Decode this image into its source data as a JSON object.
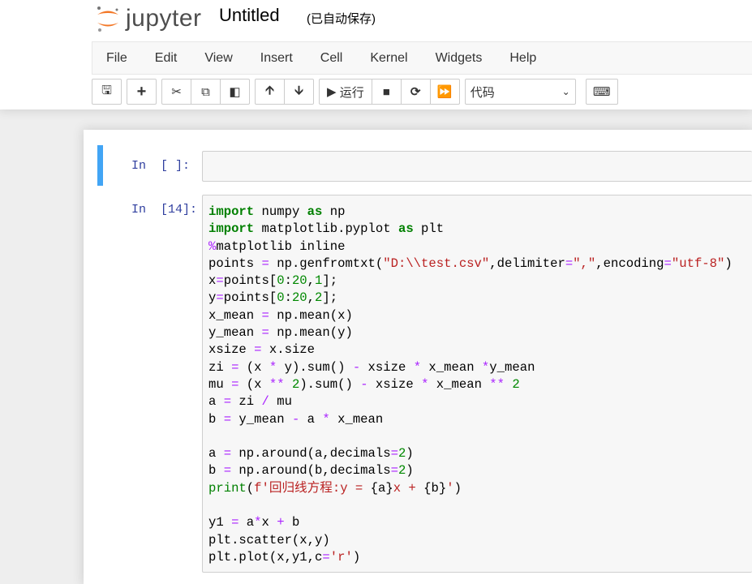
{
  "header": {
    "logo_text": "jupyter",
    "title": "Untitled",
    "save_status": "(已自动保存)"
  },
  "menu": [
    "File",
    "Edit",
    "View",
    "Insert",
    "Cell",
    "Kernel",
    "Widgets",
    "Help"
  ],
  "toolbar": {
    "run_label": "运行",
    "cell_type": "代码",
    "icons": [
      "save-icon",
      "plus-icon",
      "cut-icon",
      "copy-icon",
      "paste-icon",
      "arrow-up-icon",
      "arrow-down-icon",
      "play-icon",
      "stop-icon",
      "restart-icon",
      "fast-forward-icon",
      "keyboard-icon"
    ]
  },
  "cells": [
    {
      "prompt": "In  [ ]:"
    },
    {
      "prompt": "In  [14]:",
      "lines": [
        [
          [
            "import",
            "kw"
          ],
          [
            " numpy ",
            ""
          ],
          [
            "as",
            "kw"
          ],
          [
            " np",
            ""
          ]
        ],
        [
          [
            "import",
            "kw"
          ],
          [
            " matplotlib.pyplot ",
            ""
          ],
          [
            "as",
            "kw"
          ],
          [
            " plt",
            ""
          ]
        ],
        [
          [
            "%",
            "mg"
          ],
          [
            "matplotlib inline",
            ""
          ]
        ],
        [
          [
            "points ",
            ""
          ],
          [
            "=",
            "op"
          ],
          [
            " np.genfromtxt(",
            ""
          ],
          [
            "\"D:\\\\test.csv\"",
            "str"
          ],
          [
            ",delimiter",
            ""
          ],
          [
            "=",
            "op"
          ],
          [
            "\",\"",
            "str"
          ],
          [
            ",encoding",
            ""
          ],
          [
            "=",
            "op"
          ],
          [
            "\"utf-8\"",
            "str"
          ],
          [
            ")",
            ""
          ]
        ],
        [
          [
            "x",
            ""
          ],
          [
            "=",
            "op"
          ],
          [
            "points[",
            ""
          ],
          [
            "0",
            "num"
          ],
          [
            ":",
            ""
          ],
          [
            "20",
            "num"
          ],
          [
            ",",
            ""
          ],
          [
            "1",
            "num"
          ],
          [
            "];",
            ""
          ]
        ],
        [
          [
            "y",
            ""
          ],
          [
            "=",
            "op"
          ],
          [
            "points[",
            ""
          ],
          [
            "0",
            "num"
          ],
          [
            ":",
            ""
          ],
          [
            "20",
            "num"
          ],
          [
            ",",
            ""
          ],
          [
            "2",
            "num"
          ],
          [
            "];",
            ""
          ]
        ],
        [
          [
            "x_mean ",
            ""
          ],
          [
            "=",
            "op"
          ],
          [
            " np.mean(x)",
            ""
          ]
        ],
        [
          [
            "y_mean ",
            ""
          ],
          [
            "=",
            "op"
          ],
          [
            " np.mean(y)",
            ""
          ]
        ],
        [
          [
            "xsize ",
            ""
          ],
          [
            "=",
            "op"
          ],
          [
            " x.size",
            ""
          ]
        ],
        [
          [
            "zi ",
            ""
          ],
          [
            "=",
            "op"
          ],
          [
            " (x ",
            ""
          ],
          [
            "*",
            "op"
          ],
          [
            " y).sum() ",
            ""
          ],
          [
            "-",
            "op"
          ],
          [
            " xsize ",
            ""
          ],
          [
            "*",
            "op"
          ],
          [
            " x_mean ",
            ""
          ],
          [
            "*",
            "op"
          ],
          [
            "y_mean",
            ""
          ]
        ],
        [
          [
            "mu ",
            ""
          ],
          [
            "=",
            "op"
          ],
          [
            " (x ",
            ""
          ],
          [
            "**",
            "op"
          ],
          [
            " ",
            ""
          ],
          [
            "2",
            "num"
          ],
          [
            ").sum() ",
            ""
          ],
          [
            "-",
            "op"
          ],
          [
            " xsize ",
            ""
          ],
          [
            "*",
            "op"
          ],
          [
            " x_mean ",
            ""
          ],
          [
            "**",
            "op"
          ],
          [
            " ",
            ""
          ],
          [
            "2",
            "num"
          ]
        ],
        [
          [
            "a ",
            ""
          ],
          [
            "=",
            "op"
          ],
          [
            " zi ",
            ""
          ],
          [
            "/",
            "op"
          ],
          [
            " mu",
            ""
          ]
        ],
        [
          [
            "b ",
            ""
          ],
          [
            "=",
            "op"
          ],
          [
            " y_mean ",
            ""
          ],
          [
            "-",
            "op"
          ],
          [
            " a ",
            ""
          ],
          [
            "*",
            "op"
          ],
          [
            " x_mean",
            ""
          ]
        ],
        [],
        [
          [
            "a ",
            ""
          ],
          [
            "=",
            "op"
          ],
          [
            " np.around(a,decimals",
            ""
          ],
          [
            "=",
            "op"
          ],
          [
            "2",
            "num"
          ],
          [
            ")",
            ""
          ]
        ],
        [
          [
            "b ",
            ""
          ],
          [
            "=",
            "op"
          ],
          [
            " np.around(b,decimals",
            ""
          ],
          [
            "=",
            "op"
          ],
          [
            "2",
            "num"
          ],
          [
            ")",
            ""
          ]
        ],
        [
          [
            "print",
            "bi"
          ],
          [
            "(",
            ""
          ],
          [
            "f'回归线方程:y = ",
            "str"
          ],
          [
            "{a}",
            ""
          ],
          [
            "x + ",
            "str"
          ],
          [
            "{b}",
            ""
          ],
          [
            "'",
            "str"
          ],
          [
            ")",
            ""
          ]
        ],
        [],
        [
          [
            "y1 ",
            ""
          ],
          [
            "=",
            "op"
          ],
          [
            " a",
            ""
          ],
          [
            "*",
            "op"
          ],
          [
            "x ",
            ""
          ],
          [
            "+",
            "op"
          ],
          [
            " b",
            ""
          ]
        ],
        [
          [
            "plt.scatter(x,y)",
            ""
          ]
        ],
        [
          [
            "plt.plot(x,y1,c",
            ""
          ],
          [
            "=",
            "op"
          ],
          [
            "'r'",
            "str"
          ],
          [
            ")",
            ""
          ]
        ]
      ]
    }
  ]
}
